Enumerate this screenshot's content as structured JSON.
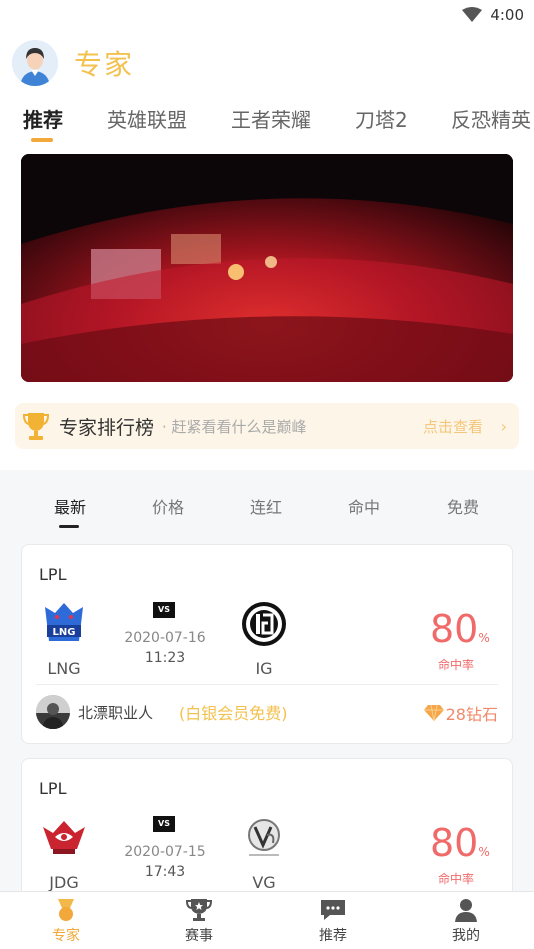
{
  "status_bar": {
    "time": "4:00"
  },
  "header": {
    "title": "专家"
  },
  "tabs": [
    {
      "label": "推荐",
      "active": true
    },
    {
      "label": "英雄联盟"
    },
    {
      "label": "王者荣耀"
    },
    {
      "label": "刀塔2"
    },
    {
      "label": "反恐精英"
    }
  ],
  "rank_bar": {
    "title": "专家排行榜",
    "subtitle": "· 赶紧看看什么是巅峰",
    "link": "点击查看",
    "arrow": "›"
  },
  "sort_tabs": [
    {
      "label": "最新",
      "active": true
    },
    {
      "label": "价格"
    },
    {
      "label": "连红"
    },
    {
      "label": "命中"
    },
    {
      "label": "免费"
    }
  ],
  "cards": [
    {
      "league": "LPL",
      "vs": "VS",
      "team_a": {
        "name": "LNG"
      },
      "team_b": {
        "name": "IG"
      },
      "date": "2020-07-16",
      "time": "11:23",
      "rate": "80",
      "rate_unit": "%",
      "rate_label": "命中率",
      "expert": "北漂职业人",
      "free_tag": "(白银会员免费)",
      "price": "28钻石"
    },
    {
      "league": "LPL",
      "vs": "VS",
      "team_a": {
        "name": "JDG"
      },
      "team_b": {
        "name": "VG"
      },
      "date": "2020-07-15",
      "time": "17:43",
      "rate": "80",
      "rate_unit": "%",
      "rate_label": "命中率"
    }
  ],
  "bottom_nav": [
    {
      "label": "专家",
      "icon": "expert-icon",
      "active": true
    },
    {
      "label": "赛事",
      "icon": "trophy-icon"
    },
    {
      "label": "推荐",
      "icon": "chat-icon"
    },
    {
      "label": "我的",
      "icon": "user-icon"
    }
  ],
  "colors": {
    "accent": "#f3c14f",
    "active_tab_bar": "#f2a83a",
    "rate": "#f06a6a"
  }
}
